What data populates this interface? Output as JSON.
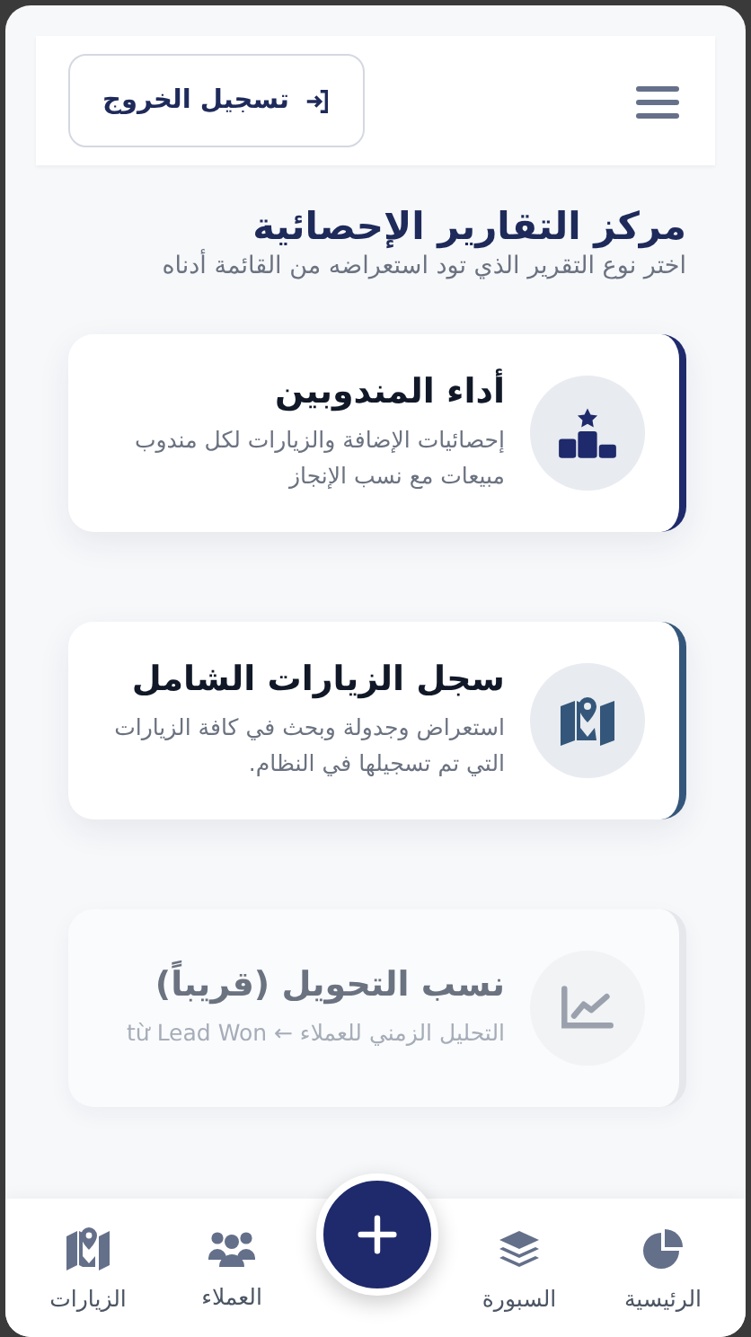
{
  "header": {
    "logout_button": "تسجيل الخروج"
  },
  "page": {
    "title": "مركز التقارير الإحصائية",
    "subtitle": "اختر نوع التقرير الذي تود استعراضه من القائمة أدناه"
  },
  "reports": [
    {
      "title": "أداء المندوبين",
      "description": "إحصائيات الإضافة والزيارات لكل مندوب مبيعات مع نسب الإنجاز",
      "color": "#1e2a6b",
      "disabled": false
    },
    {
      "title": "سجل الزيارات الشامل",
      "description": "استعراض وجدولة وبحث في كافة الزيارات التي تم تسجيلها في النظام.",
      "color": "#34567a",
      "disabled": false
    },
    {
      "title": "نسب التحويل (قريباً)",
      "description": "التحليل الزمني للعملاء ← từ Lead Won",
      "color": "#e5e7eb",
      "disabled": true
    }
  ],
  "bottom_nav": [
    "الرئيسية",
    "السبورة",
    "العملاء",
    "الزيارات"
  ]
}
